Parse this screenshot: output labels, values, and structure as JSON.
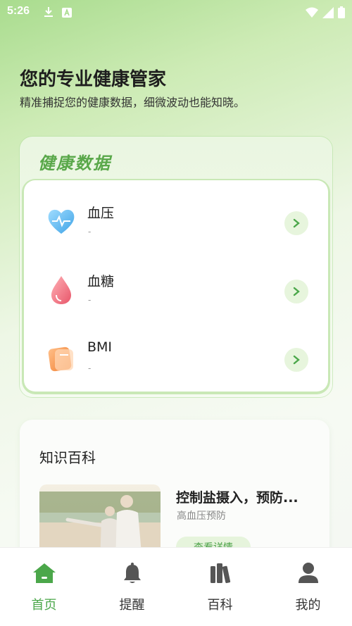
{
  "status_bar": {
    "time": "5:26"
  },
  "hero": {
    "title": "您的专业健康管家",
    "subtitle": "精准捕捉您的健康数据，细微波动也能知晓。"
  },
  "health_data": {
    "title": "健康数据",
    "items": [
      {
        "name": "血压",
        "value": "-",
        "icon": "heart-pulse-icon",
        "color": "#5bb6ee"
      },
      {
        "name": "血糖",
        "value": "-",
        "icon": "blood-drop-icon",
        "color": "#f07a84"
      },
      {
        "name": "BMI",
        "value": "-",
        "icon": "scale-icon",
        "color": "#f4964a"
      }
    ]
  },
  "knowledge": {
    "title": "知识百科",
    "article": {
      "title": "控制盐摄入，预防...",
      "tag": "高血压预防",
      "button_label": "查看详情"
    }
  },
  "tab_bar": {
    "items": [
      {
        "label": "首页",
        "icon": "home-icon",
        "active": true
      },
      {
        "label": "提醒",
        "icon": "bell-icon",
        "active": false
      },
      {
        "label": "百科",
        "icon": "books-icon",
        "active": false
      },
      {
        "label": "我的",
        "icon": "user-icon",
        "active": false
      }
    ]
  },
  "colors": {
    "accent": "#4ba74a",
    "inactive_icon": "#555555"
  }
}
